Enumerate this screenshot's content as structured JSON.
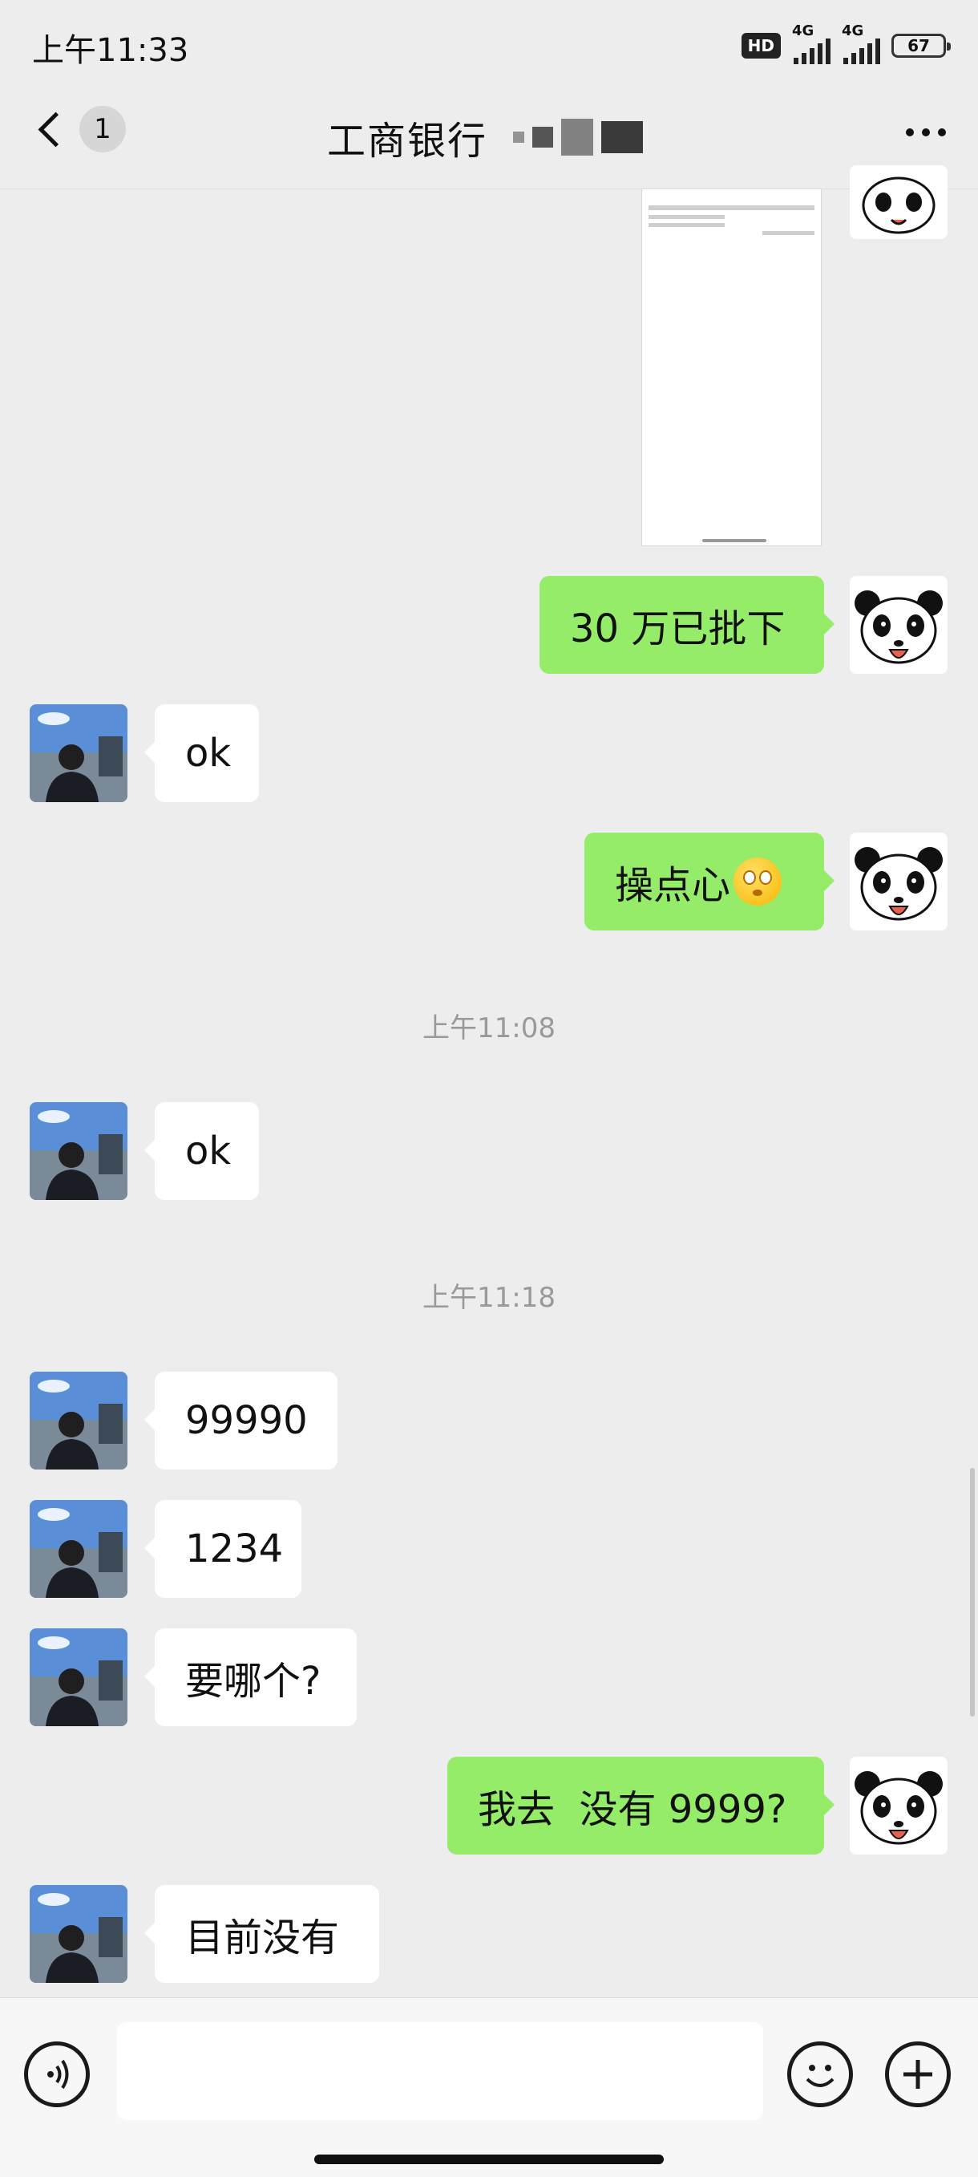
{
  "status_bar": {
    "time": "上午11:33",
    "hd_label": "HD",
    "network_1": "4G",
    "network_2": "4G",
    "battery": "67"
  },
  "header": {
    "unread_count": "1",
    "title": "工商银行"
  },
  "messages": [
    {
      "side": "me",
      "type": "image"
    },
    {
      "side": "me",
      "text": "30 万已批下"
    },
    {
      "side": "other",
      "text": "ok"
    },
    {
      "side": "me",
      "text": "操点心",
      "emoji": "rolling-eyes-emoji"
    },
    {
      "type": "timestamp",
      "text": "上午11:08"
    },
    {
      "side": "other",
      "text": "ok"
    },
    {
      "type": "timestamp",
      "text": "上午11:18"
    },
    {
      "side": "other",
      "text": "99990"
    },
    {
      "side": "other",
      "text": "1234"
    },
    {
      "side": "other",
      "text": "要哪个?"
    },
    {
      "side": "me",
      "text": "我去  没有 9999?"
    },
    {
      "side": "other",
      "text": "目前没有"
    }
  ],
  "input_bar": {
    "placeholder": "",
    "icons": [
      "voice-icon",
      "emoji-icon",
      "plus-icon"
    ]
  },
  "colors": {
    "my_bubble": "#95ec69",
    "other_bubble": "#ffffff",
    "background": "#ededed"
  }
}
